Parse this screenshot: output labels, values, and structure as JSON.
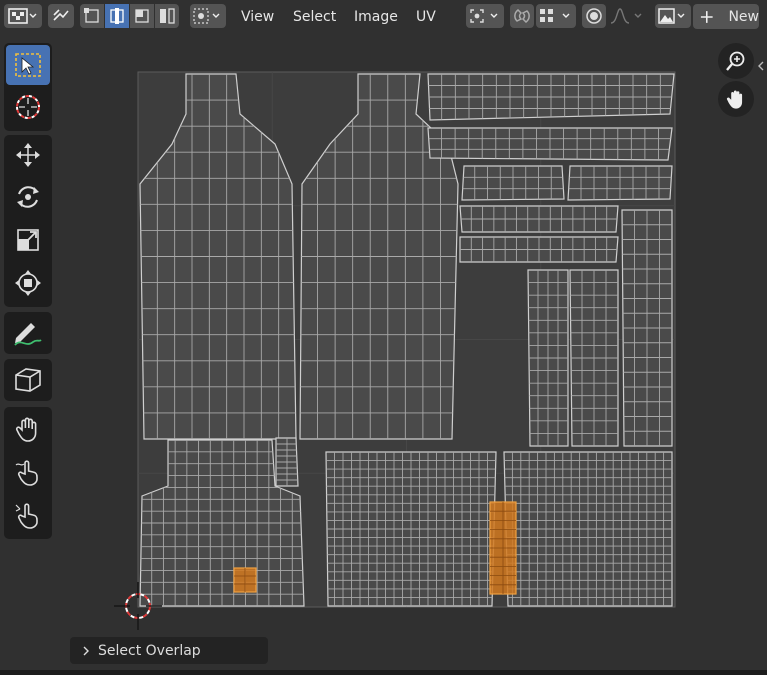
{
  "header": {
    "menus": [
      {
        "id": "view",
        "label": "View"
      },
      {
        "id": "select",
        "label": "Select"
      },
      {
        "id": "image",
        "label": "Image"
      },
      {
        "id": "uv",
        "label": "UV"
      }
    ],
    "new_label": "New",
    "new_icon": "plus-icon"
  },
  "toolbar": {
    "tools": [
      "select-box",
      "cursor",
      "move",
      "rotate",
      "scale",
      "transform",
      "annotate",
      "rip-region",
      "grab",
      "relax",
      "pinch"
    ]
  },
  "navigation": {
    "zoom_icon": "zoom-icon",
    "pan_icon": "hand-icon"
  },
  "overlay_panel": {
    "label": "Select Overlap"
  },
  "colors": {
    "background": "#303030",
    "active_blue": "#4772b3",
    "mesh_fill": "#4a4a4a",
    "mesh_edge": "#cfcfcf",
    "selected_face": "#d2791f",
    "cursor_red": "#e03a3a"
  }
}
